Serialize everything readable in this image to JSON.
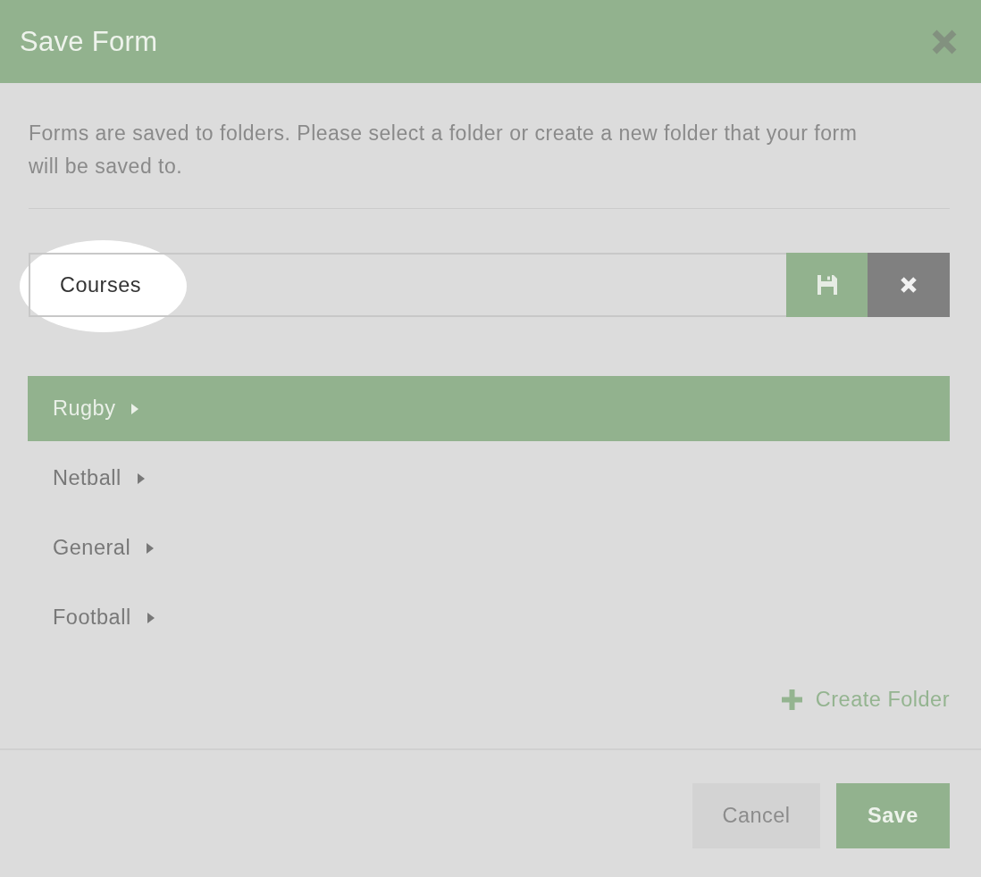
{
  "dialog": {
    "title": "Save Form"
  },
  "description": "Forms are saved to folders. Please select a folder or create a new folder that your form will be saved to.",
  "name_field": {
    "value": "Courses",
    "highlighted": true
  },
  "folders": [
    {
      "name": "Rugby",
      "selected": true
    },
    {
      "name": "Netball",
      "selected": false
    },
    {
      "name": "General",
      "selected": false
    },
    {
      "name": "Football",
      "selected": false
    }
  ],
  "create_folder": {
    "label": "Create Folder"
  },
  "buttons": [
    {
      "label": "Cancel",
      "kind": "secondary"
    },
    {
      "label": "Save",
      "kind": "primary"
    }
  ]
}
